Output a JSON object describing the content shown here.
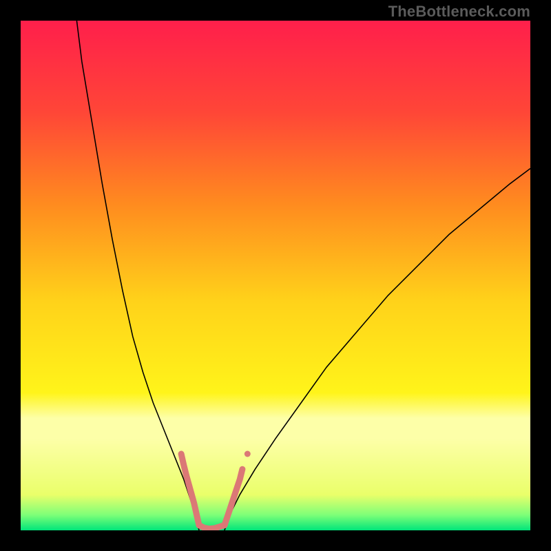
{
  "watermark": "TheBottleneck.com",
  "chart_data": {
    "type": "line",
    "title": "",
    "xlabel": "",
    "ylabel": "",
    "xlim": [
      0,
      100
    ],
    "ylim": [
      0,
      100
    ],
    "grid": false,
    "legend": false,
    "annotations": [],
    "background_gradient": {
      "type": "vertical",
      "stops": [
        {
          "pos": 0.0,
          "color": "#ff1f4b"
        },
        {
          "pos": 0.18,
          "color": "#ff4637"
        },
        {
          "pos": 0.36,
          "color": "#ff8b1f"
        },
        {
          "pos": 0.55,
          "color": "#ffd21a"
        },
        {
          "pos": 0.73,
          "color": "#fff41a"
        },
        {
          "pos": 0.78,
          "color": "#fdffa8"
        },
        {
          "pos": 0.82,
          "color": "#fdffa8"
        },
        {
          "pos": 0.93,
          "color": "#eaff6a"
        },
        {
          "pos": 0.97,
          "color": "#7dff78"
        },
        {
          "pos": 1.0,
          "color": "#00e57a"
        }
      ]
    },
    "series": [
      {
        "name": "curve-left",
        "color": "#000000",
        "width": 1.6,
        "x": [
          11,
          12,
          14,
          16,
          18,
          20,
          22,
          24,
          26,
          28,
          30,
          32,
          33,
          34,
          34.5,
          35
        ],
        "y": [
          100,
          92,
          80,
          68,
          57,
          47,
          38,
          31,
          25,
          20,
          15,
          10,
          7,
          4,
          2,
          0
        ]
      },
      {
        "name": "curve-right",
        "color": "#000000",
        "width": 1.6,
        "x": [
          40,
          41,
          43,
          46,
          50,
          55,
          60,
          66,
          72,
          78,
          84,
          90,
          96,
          100
        ],
        "y": [
          0,
          3,
          7,
          12,
          18,
          25,
          32,
          39,
          46,
          52,
          58,
          63,
          68,
          71
        ]
      },
      {
        "name": "valley-marker-left",
        "color": "#db7876",
        "width": 9,
        "cap": "round",
        "x": [
          31.5,
          32.0,
          32.5,
          33.0,
          33.5,
          34.0,
          34.5,
          35.0
        ],
        "y": [
          15.0,
          12.8,
          10.8,
          9.0,
          7.2,
          5.4,
          3.2,
          1.0
        ]
      },
      {
        "name": "valley-marker-bottom",
        "color": "#db7876",
        "width": 9,
        "cap": "round",
        "x": [
          35.0,
          36.0,
          37.0,
          38.0,
          39.0,
          40.0
        ],
        "y": [
          1.0,
          0.5,
          0.3,
          0.4,
          0.7,
          1.0
        ]
      },
      {
        "name": "valley-marker-right",
        "color": "#db7876",
        "width": 9,
        "cap": "round",
        "x": [
          40.0,
          40.5,
          41.0,
          41.5,
          42.0,
          42.5,
          43.0,
          43.5
        ],
        "y": [
          1.0,
          2.5,
          4.0,
          5.5,
          7.0,
          8.5,
          10.0,
          12.0
        ]
      },
      {
        "name": "valley-marker-dot",
        "color": "#db7876",
        "width": 9,
        "cap": "round",
        "x": [
          44.5,
          44.5
        ],
        "y": [
          15.0,
          15.0
        ]
      }
    ]
  }
}
